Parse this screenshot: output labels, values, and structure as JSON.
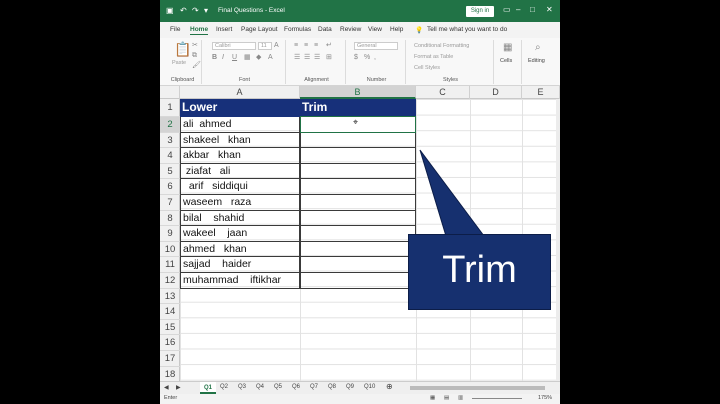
{
  "titlebar": {
    "title": "Final Questions  -  Excel",
    "signin": "Sign in"
  },
  "ribbon_tabs": [
    "File",
    "Home",
    "Insert",
    "Page Layout",
    "Formulas",
    "Data",
    "Review",
    "View",
    "Help"
  ],
  "active_tab": "Home",
  "tell_me": "Tell me what you want to do",
  "ribbon": {
    "clipboard_label": "Clipboard",
    "paste_label": "Paste",
    "font_label": "Font",
    "font_name": "Calibri",
    "font_size": "11",
    "alignment_label": "Alignment",
    "number_label": "Number",
    "number_format": "General",
    "styles_label": "Styles",
    "cond_format": "Conditional Formatting",
    "format_table": "Format as Table",
    "cell_styles": "Cell Styles",
    "cells_label": "Cells",
    "editing_label": "Editing"
  },
  "columns": [
    "A",
    "B",
    "C",
    "D",
    "E"
  ],
  "selected_column": "B",
  "rows": [
    "1",
    "2",
    "3",
    "4",
    "5",
    "6",
    "7",
    "8",
    "9",
    "10",
    "11",
    "12",
    "13",
    "14",
    "15",
    "16",
    "17",
    "18"
  ],
  "selected_row": "2",
  "headers": {
    "a1": "Lower",
    "b1": "Trim"
  },
  "formula_cell": "=",
  "names": [
    "ali  ahmed",
    "shakeel   khan",
    "akbar   khan",
    " ziafat   ali",
    "  arif   siddiqui",
    "waseem   raza",
    "bilal    shahid",
    "wakeel    jaan",
    "ahmed   khan",
    "sajjad    haider",
    "muhammad    iftikhar"
  ],
  "sheets": [
    "Q1",
    "Q2",
    "Q3",
    "Q4",
    "Q5",
    "Q6",
    "Q7",
    "Q8",
    "Q9",
    "Q10"
  ],
  "active_sheet": "Q1",
  "status": {
    "mode": "Enter",
    "zoom": "175%"
  },
  "callout": {
    "text": "Trim"
  },
  "colors": {
    "excel_green": "#217346",
    "header_fill": "#17307a",
    "callout_fill": "#16306f"
  }
}
